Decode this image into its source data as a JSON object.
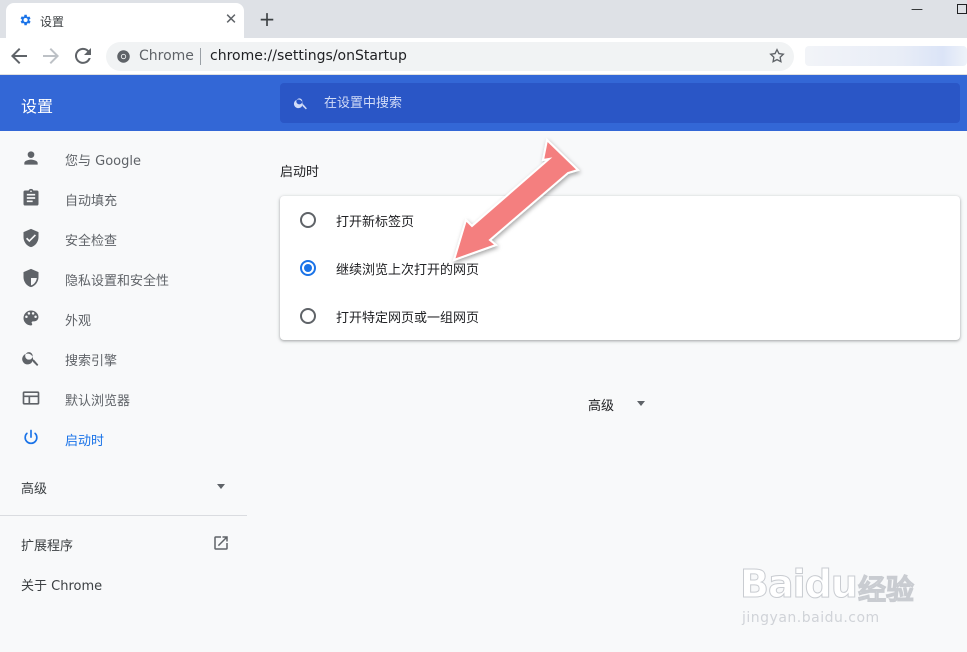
{
  "tab": {
    "title": "设置",
    "close_glyph": "✕",
    "favicon": "gear-icon"
  },
  "new_tab_glyph": "+",
  "window": {
    "minimize_glyph": "—"
  },
  "omnibox": {
    "scheme_label": "Chrome",
    "url": "chrome://settings/onStartup"
  },
  "header": {
    "title": "设置",
    "search_placeholder": "在设置中搜索"
  },
  "sidebar": {
    "items": [
      {
        "label": "您与 Google",
        "icon": "person-icon"
      },
      {
        "label": "自动填充",
        "icon": "clipboard-icon"
      },
      {
        "label": "安全检查",
        "icon": "shield-check-icon"
      },
      {
        "label": "隐私设置和安全性",
        "icon": "shield-half-icon"
      },
      {
        "label": "外观",
        "icon": "palette-icon"
      },
      {
        "label": "搜索引擎",
        "icon": "search-icon"
      },
      {
        "label": "默认浏览器",
        "icon": "browser-window-icon"
      },
      {
        "label": "启动时",
        "icon": "power-icon",
        "active": true
      }
    ],
    "advanced": "高级",
    "extensions": "扩展程序",
    "about": "关于 Chrome"
  },
  "main": {
    "section_title": "启动时",
    "options": [
      {
        "label": "打开新标签页",
        "checked": false
      },
      {
        "label": "继续浏览上次打开的网页",
        "checked": true
      },
      {
        "label": "打开特定网页或一组网页",
        "checked": false
      }
    ],
    "advanced": "高级"
  },
  "watermark": {
    "brand": "Baidu",
    "brand_cn": "经验",
    "url": "jingyan.baidu.com"
  },
  "colors": {
    "header": "#3367d6",
    "search_bg": "#2a56c6",
    "accent": "#1a73e8",
    "annotation_arrow": "#f47f7f"
  }
}
